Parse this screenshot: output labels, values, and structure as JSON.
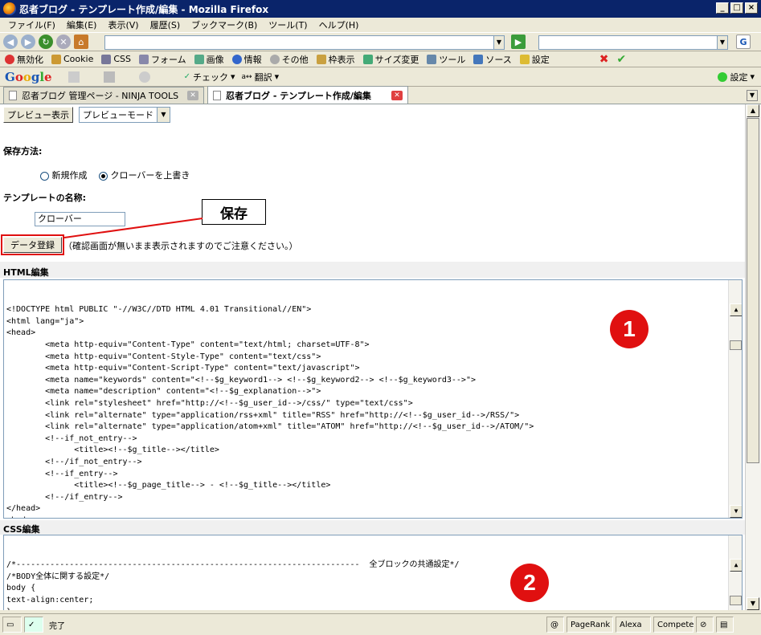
{
  "window": {
    "title": "忍者ブログ - テンプレート作成/編集 - Mozilla Firefox"
  },
  "menu": [
    "ファイル(F)",
    "編集(E)",
    "表示(V)",
    "履歴(S)",
    "ブックマーク(B)",
    "ツール(T)",
    "ヘルプ(H)"
  ],
  "toolbar": {
    "items": [
      "無効化",
      "Cookie",
      "CSS",
      "フォーム",
      "画像",
      "情報",
      "その他",
      "枠表示",
      "サイズ変更",
      "ツール",
      "ソース",
      "設定"
    ]
  },
  "google_bar": {
    "logo": "Google",
    "check": "チェック",
    "translate": "翻訳",
    "settings": "設定"
  },
  "tabs": [
    {
      "label": "忍者ブログ 管理ページ - NINJA TOOLS"
    },
    {
      "label": "忍者ブログ - テンプレート作成/編集"
    }
  ],
  "page": {
    "preview_button": "プレビュー表示",
    "preview_mode": "プレビューモード",
    "save_method_label": "保存方法:",
    "radio_new": "新規作成",
    "radio_overwrite": "クローバーを上書き",
    "template_name_label": "テンプレートの名称:",
    "template_name_value": "クローバー",
    "data_register_button": "データ登録",
    "note": "（確認画面が無いまま表示されますのでご注意ください。）",
    "html_label": "HTML編集",
    "html_code": "<!DOCTYPE html PUBLIC \"-//W3C//DTD HTML 4.01 Transitional//EN\">\n<html lang=\"ja\">\n<head>\n        <meta http-equiv=\"Content-Type\" content=\"text/html; charset=UTF-8\">\n        <meta http-equiv=\"Content-Style-Type\" content=\"text/css\">\n        <meta http-equiv=\"Content-Script-Type\" content=\"text/javascript\">\n        <meta name=\"keywords\" content=\"<!--$g_keyword1--> <!--$g_keyword2--> <!--$g_keyword3-->\">\n        <meta name=\"description\" content=\"<!--$g_explanation-->\">\n        <link rel=\"stylesheet\" href=\"http://<!--$g_user_id-->/css/\" type=\"text/css\">\n        <link rel=\"alternate\" type=\"application/rss+xml\" title=\"RSS\" href=\"http://<!--$g_user_id-->/RSS/\">\n        <link rel=\"alternate\" type=\"application/atom+xml\" title=\"ATOM\" href=\"http://<!--$g_user_id-->/ATOM/\">\n        <!--if_not_entry-->\n              <title><!--$g_title--></title>\n        <!--/if_not_entry-->\n        <!--if_entry-->\n              <title><!--$g_page_title--> - <!--$g_title--></title>\n        <!--/if_entry-->\n</head>\n<body>\n<div id=\"mainBlock\">\n        <div id=\"TopBlock\">",
    "css_label": "CSS編集",
    "css_code": "/*-----------------------------------------------------------------------  全ブロックの共通設定*/\n/*BODY全体に関する設定*/\nbody {\ntext-align:center;\n}\n/*tableの設定*/",
    "callout_save": "保存",
    "badge_1": "1",
    "badge_2": "2"
  },
  "status": {
    "text": "完了",
    "pagerank": "PageRank",
    "alexa": "Alexa",
    "compete": "Compete"
  },
  "colors": {
    "titlebar": "#0a246a",
    "highlight": "#e01010",
    "chrome": "#ece9d8"
  }
}
